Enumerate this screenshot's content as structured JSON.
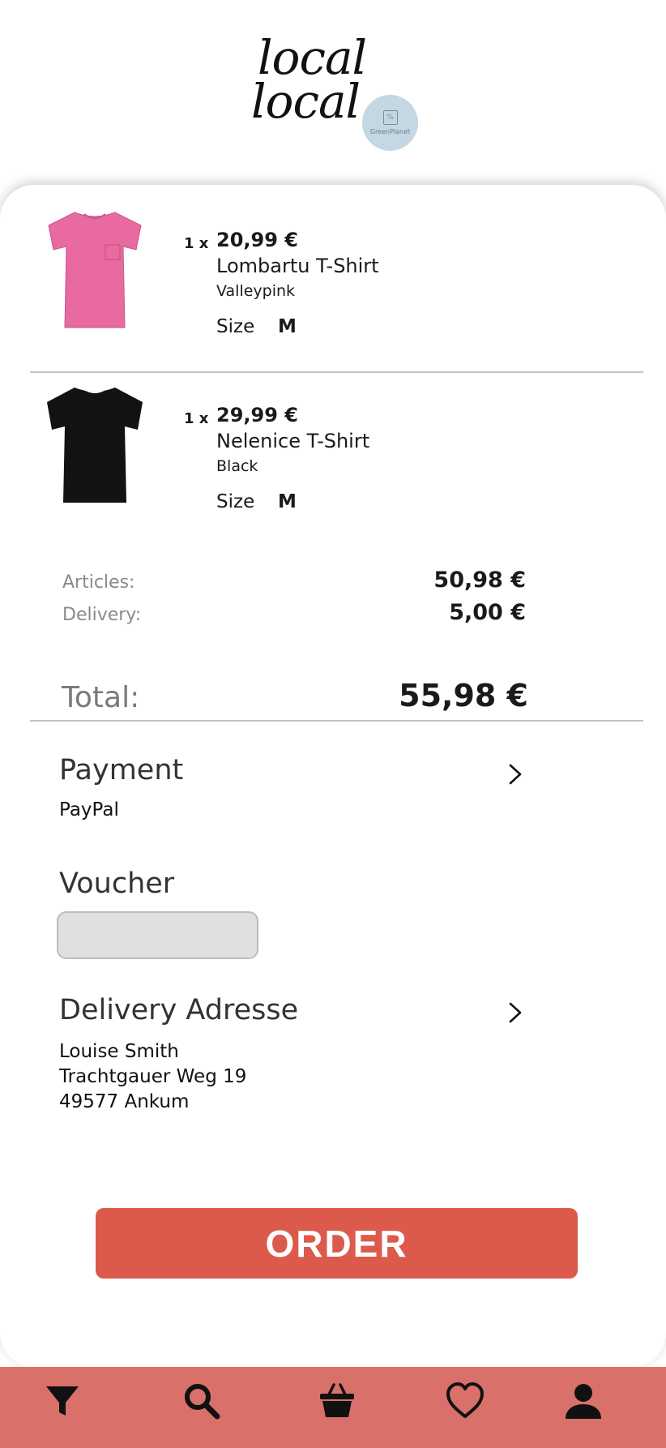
{
  "brand": {
    "logo_line1": "local",
    "logo_line2": "local",
    "badge_text": "GreenPlanet"
  },
  "cart": {
    "items": [
      {
        "qty": "1 x",
        "price": "20,99 €",
        "name": "Lombartu T-Shirt",
        "color": "Valleypink",
        "size_label": "Size",
        "size": "M",
        "image_icon": "pink-tshirt",
        "image_color": "#e86aa0"
      },
      {
        "qty": "1 x",
        "price": "29,99 €",
        "name": "Nelenice T-Shirt",
        "color": "Black",
        "size_label": "Size",
        "size": "M",
        "image_icon": "black-tshirt",
        "image_color": "#121212"
      }
    ]
  },
  "summary": {
    "articles_label": "Articles:",
    "articles_value": "50,98 €",
    "delivery_label": "Delivery:",
    "delivery_value": "5,00 €",
    "total_label": "Total:",
    "total_value": "55,98 €"
  },
  "payment": {
    "title": "Payment",
    "method": "PayPal"
  },
  "voucher": {
    "title": "Voucher",
    "value": ""
  },
  "delivery_address": {
    "title": "Delivery Adresse",
    "name": "Louise Smith",
    "street": "Trachtgauer Weg 19",
    "city": "49577 Ankum"
  },
  "actions": {
    "order_label": "ORDER"
  },
  "nav": {
    "icons": [
      "filter-icon",
      "search-icon",
      "basket-icon",
      "heart-icon",
      "user-icon"
    ]
  },
  "colors": {
    "accent": "#dc5a4c",
    "nav_background": "#d9706a",
    "badge": "#c5d7e3"
  }
}
